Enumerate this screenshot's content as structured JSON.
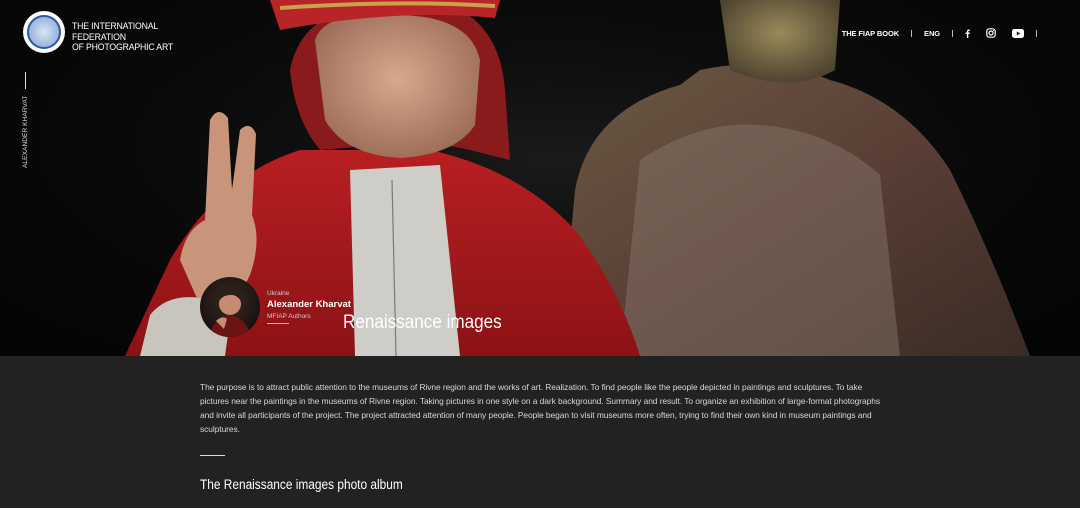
{
  "brand": {
    "line1": "THE INTERNATIONAL FEDERATION",
    "line2": "OF PHOTOGRAPHIC ART"
  },
  "nav": {
    "book": "THE FIAP BOOK",
    "lang": "ENG",
    "icons": [
      "facebook-icon",
      "instagram-icon",
      "youtube-icon",
      "menu-icon"
    ]
  },
  "side_label": "ALEXANDER KHARVAT",
  "author": {
    "country": "Ukraine",
    "name": "Alexander Kharvat",
    "title": "MFIAP Authors"
  },
  "project": {
    "title": "Renaissance images"
  },
  "description": "The purpose is to attract public attention to the museums of Rivne region and the works of art. Realization. To find people like the people depicted in paintings and sculptures. To take pictures near the paintings in the museums of Rivne region. Taking pictures in one style on a dark background. Summary and result. To organize an exhibition of large-format photographs and invite all participants  of the project. The project attracted attention of many people. People began to visit museums more often, trying to find their own kind in museum paintings and sculptures.",
  "album": {
    "title": "The Renaissance images photo album"
  },
  "colors": {
    "background": "#222222",
    "hero_red": "#a8191c",
    "text": "#ffffff"
  }
}
